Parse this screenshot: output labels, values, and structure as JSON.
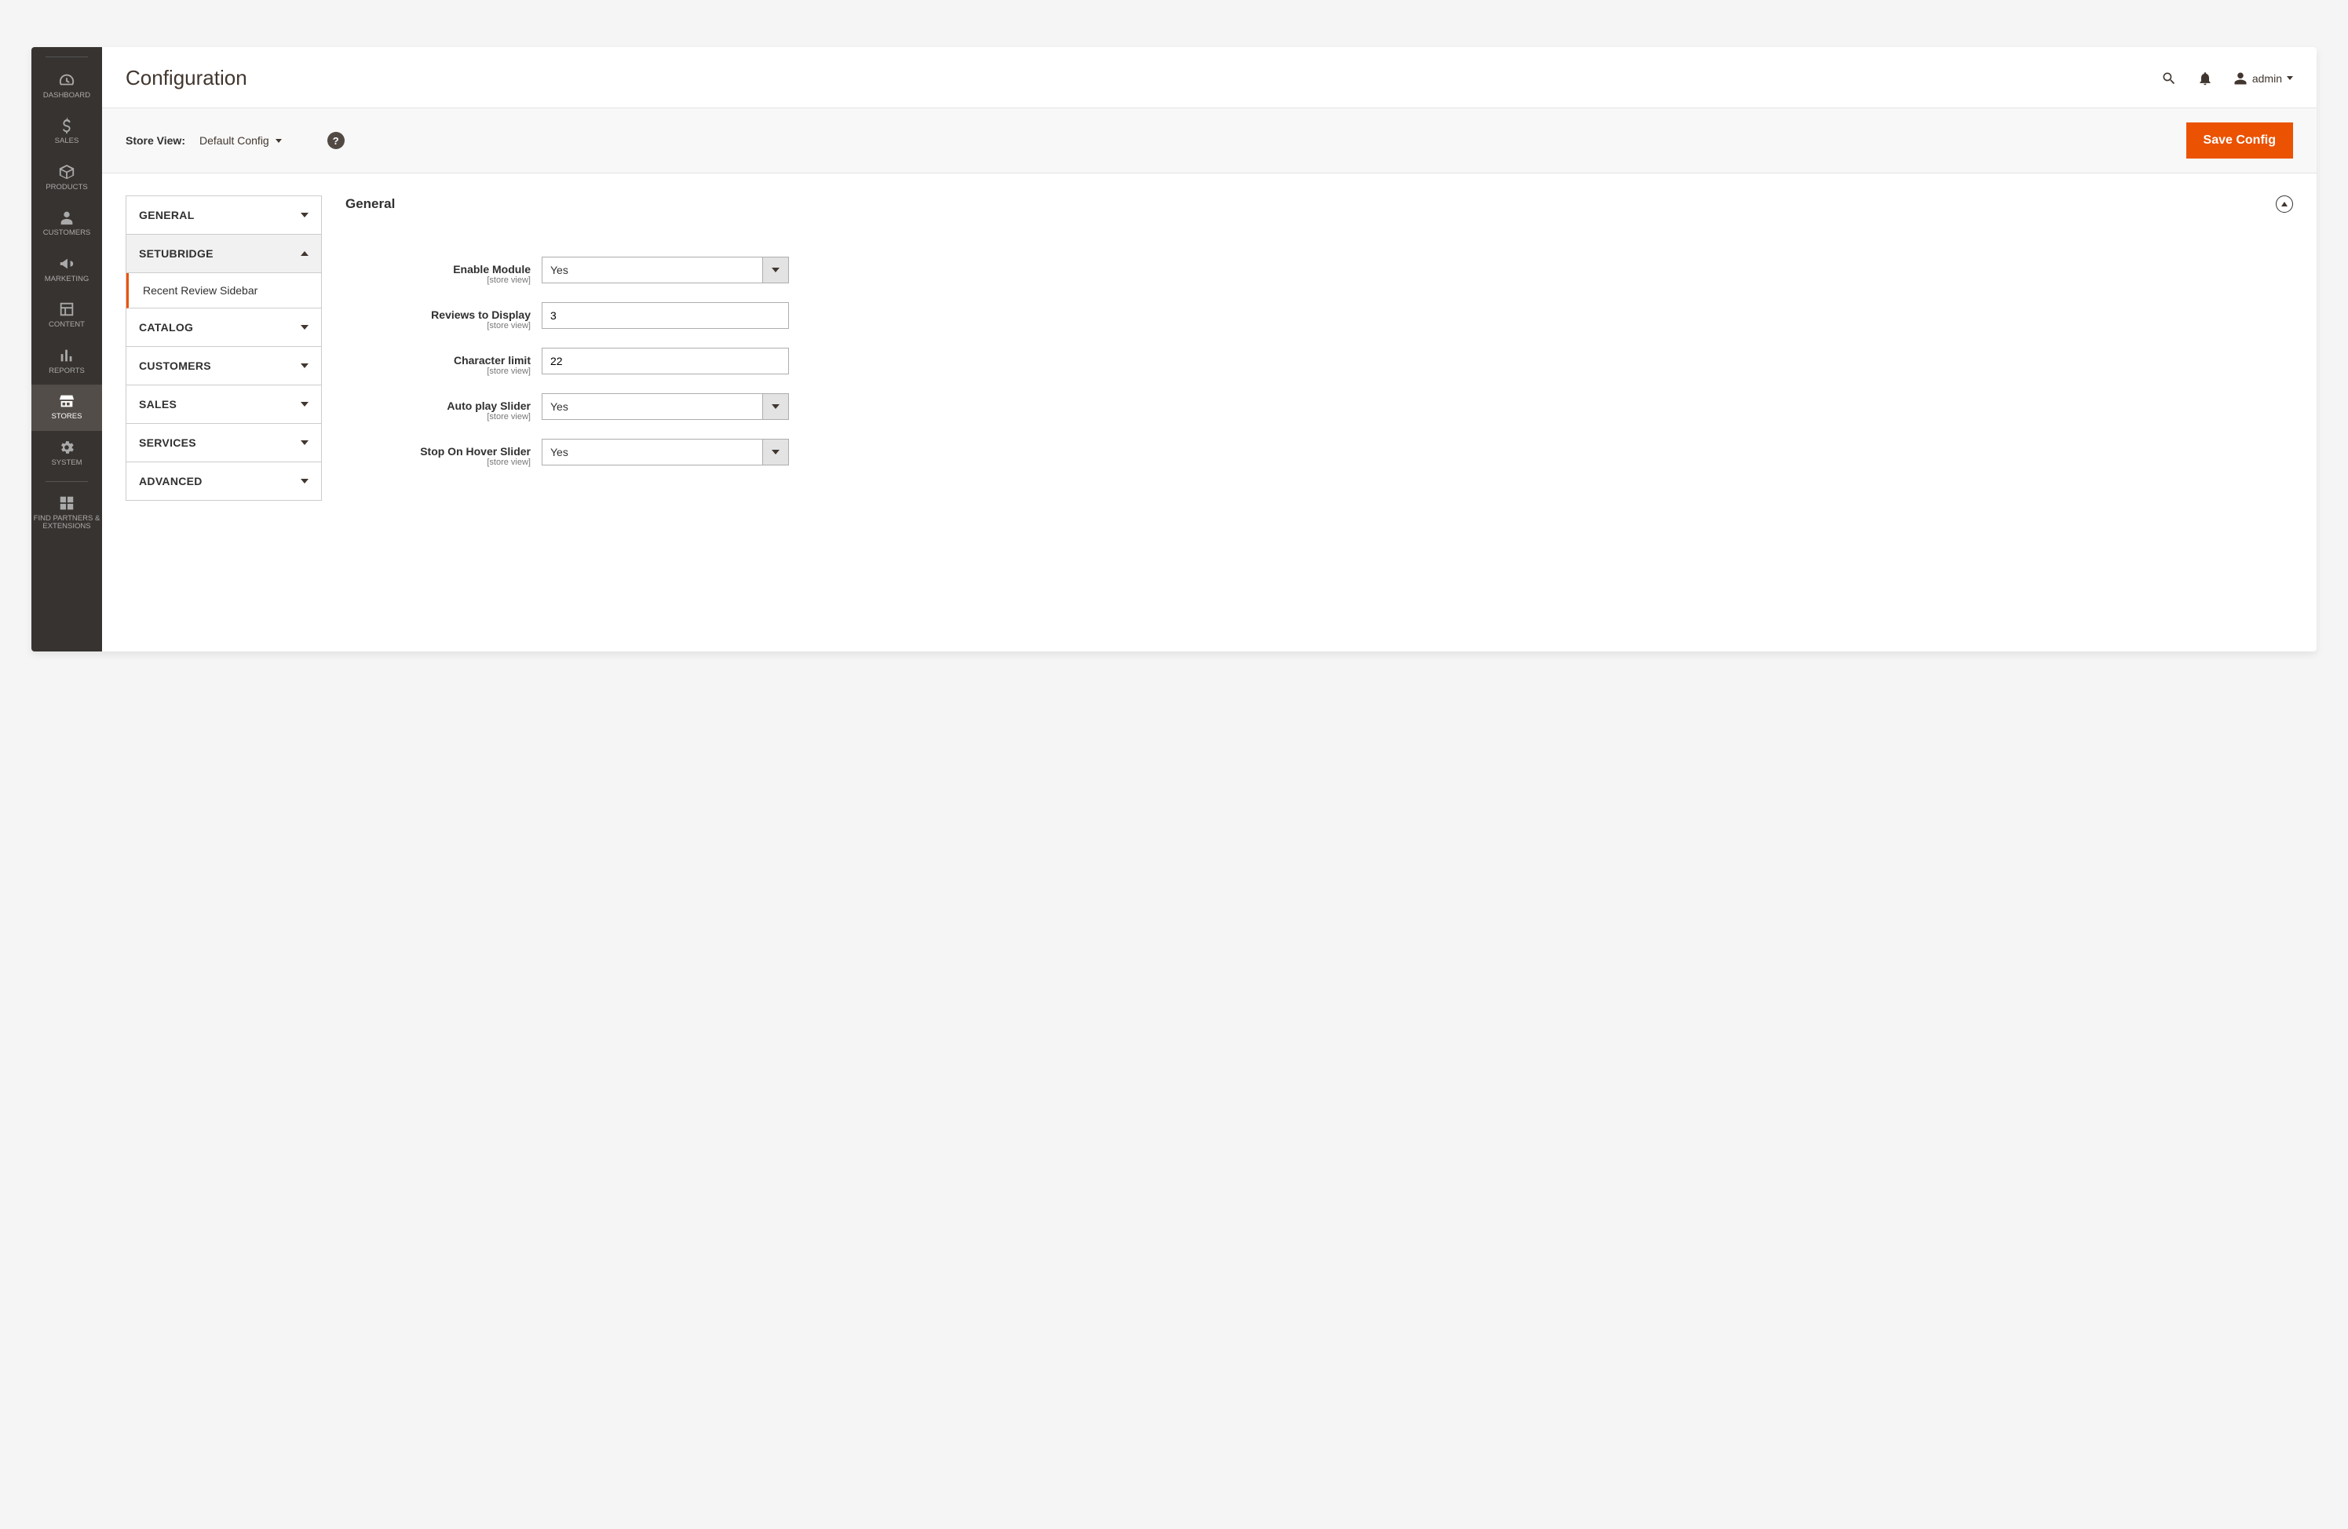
{
  "sidenav": {
    "items": [
      {
        "label": "DASHBOARD",
        "icon": "gauge"
      },
      {
        "label": "SALES",
        "icon": "dollar"
      },
      {
        "label": "PRODUCTS",
        "icon": "box"
      },
      {
        "label": "CUSTOMERS",
        "icon": "person"
      },
      {
        "label": "MARKETING",
        "icon": "megaphone"
      },
      {
        "label": "CONTENT",
        "icon": "layout"
      },
      {
        "label": "REPORTS",
        "icon": "bars"
      },
      {
        "label": "STORES",
        "icon": "store"
      },
      {
        "label": "SYSTEM",
        "icon": "gear"
      },
      {
        "label": "FIND PARTNERS & EXTENSIONS",
        "icon": "blocks"
      }
    ],
    "active_index": 7
  },
  "header": {
    "title": "Configuration",
    "user": "admin"
  },
  "scopebar": {
    "label": "Store View:",
    "value": "Default Config",
    "save_label": "Save Config"
  },
  "config_nav": {
    "groups": [
      {
        "label": "GENERAL",
        "expanded": false
      },
      {
        "label": "SETUBRIDGE",
        "expanded": true,
        "sub": [
          {
            "label": "Recent Review Sidebar",
            "active": true
          }
        ]
      },
      {
        "label": "CATALOG",
        "expanded": false
      },
      {
        "label": "CUSTOMERS",
        "expanded": false
      },
      {
        "label": "SALES",
        "expanded": false
      },
      {
        "label": "SERVICES",
        "expanded": false
      },
      {
        "label": "ADVANCED",
        "expanded": false
      }
    ]
  },
  "section": {
    "title": "General",
    "scope_hint": "[store view]",
    "fields": [
      {
        "label": "Enable Module",
        "type": "select",
        "value": "Yes"
      },
      {
        "label": "Reviews to Display",
        "type": "text",
        "value": "3"
      },
      {
        "label": "Character limit",
        "type": "text",
        "value": "22"
      },
      {
        "label": "Auto play Slider",
        "type": "select",
        "value": "Yes"
      },
      {
        "label": "Stop On Hover Slider",
        "type": "select",
        "value": "Yes"
      }
    ]
  }
}
